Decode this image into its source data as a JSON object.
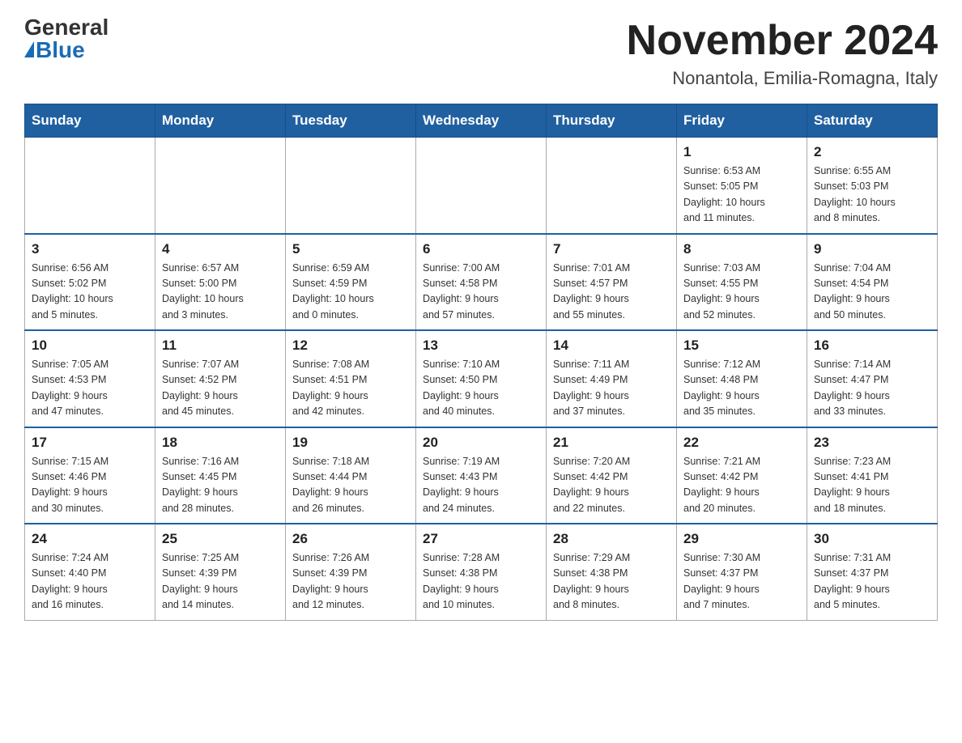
{
  "header": {
    "logo_general": "General",
    "logo_blue": "Blue",
    "title": "November 2024",
    "subtitle": "Nonantola, Emilia-Romagna, Italy"
  },
  "days_of_week": [
    "Sunday",
    "Monday",
    "Tuesday",
    "Wednesday",
    "Thursday",
    "Friday",
    "Saturday"
  ],
  "weeks": [
    [
      {
        "day": "",
        "info": ""
      },
      {
        "day": "",
        "info": ""
      },
      {
        "day": "",
        "info": ""
      },
      {
        "day": "",
        "info": ""
      },
      {
        "day": "",
        "info": ""
      },
      {
        "day": "1",
        "info": "Sunrise: 6:53 AM\nSunset: 5:05 PM\nDaylight: 10 hours\nand 11 minutes."
      },
      {
        "day": "2",
        "info": "Sunrise: 6:55 AM\nSunset: 5:03 PM\nDaylight: 10 hours\nand 8 minutes."
      }
    ],
    [
      {
        "day": "3",
        "info": "Sunrise: 6:56 AM\nSunset: 5:02 PM\nDaylight: 10 hours\nand 5 minutes."
      },
      {
        "day": "4",
        "info": "Sunrise: 6:57 AM\nSunset: 5:00 PM\nDaylight: 10 hours\nand 3 minutes."
      },
      {
        "day": "5",
        "info": "Sunrise: 6:59 AM\nSunset: 4:59 PM\nDaylight: 10 hours\nand 0 minutes."
      },
      {
        "day": "6",
        "info": "Sunrise: 7:00 AM\nSunset: 4:58 PM\nDaylight: 9 hours\nand 57 minutes."
      },
      {
        "day": "7",
        "info": "Sunrise: 7:01 AM\nSunset: 4:57 PM\nDaylight: 9 hours\nand 55 minutes."
      },
      {
        "day": "8",
        "info": "Sunrise: 7:03 AM\nSunset: 4:55 PM\nDaylight: 9 hours\nand 52 minutes."
      },
      {
        "day": "9",
        "info": "Sunrise: 7:04 AM\nSunset: 4:54 PM\nDaylight: 9 hours\nand 50 minutes."
      }
    ],
    [
      {
        "day": "10",
        "info": "Sunrise: 7:05 AM\nSunset: 4:53 PM\nDaylight: 9 hours\nand 47 minutes."
      },
      {
        "day": "11",
        "info": "Sunrise: 7:07 AM\nSunset: 4:52 PM\nDaylight: 9 hours\nand 45 minutes."
      },
      {
        "day": "12",
        "info": "Sunrise: 7:08 AM\nSunset: 4:51 PM\nDaylight: 9 hours\nand 42 minutes."
      },
      {
        "day": "13",
        "info": "Sunrise: 7:10 AM\nSunset: 4:50 PM\nDaylight: 9 hours\nand 40 minutes."
      },
      {
        "day": "14",
        "info": "Sunrise: 7:11 AM\nSunset: 4:49 PM\nDaylight: 9 hours\nand 37 minutes."
      },
      {
        "day": "15",
        "info": "Sunrise: 7:12 AM\nSunset: 4:48 PM\nDaylight: 9 hours\nand 35 minutes."
      },
      {
        "day": "16",
        "info": "Sunrise: 7:14 AM\nSunset: 4:47 PM\nDaylight: 9 hours\nand 33 minutes."
      }
    ],
    [
      {
        "day": "17",
        "info": "Sunrise: 7:15 AM\nSunset: 4:46 PM\nDaylight: 9 hours\nand 30 minutes."
      },
      {
        "day": "18",
        "info": "Sunrise: 7:16 AM\nSunset: 4:45 PM\nDaylight: 9 hours\nand 28 minutes."
      },
      {
        "day": "19",
        "info": "Sunrise: 7:18 AM\nSunset: 4:44 PM\nDaylight: 9 hours\nand 26 minutes."
      },
      {
        "day": "20",
        "info": "Sunrise: 7:19 AM\nSunset: 4:43 PM\nDaylight: 9 hours\nand 24 minutes."
      },
      {
        "day": "21",
        "info": "Sunrise: 7:20 AM\nSunset: 4:42 PM\nDaylight: 9 hours\nand 22 minutes."
      },
      {
        "day": "22",
        "info": "Sunrise: 7:21 AM\nSunset: 4:42 PM\nDaylight: 9 hours\nand 20 minutes."
      },
      {
        "day": "23",
        "info": "Sunrise: 7:23 AM\nSunset: 4:41 PM\nDaylight: 9 hours\nand 18 minutes."
      }
    ],
    [
      {
        "day": "24",
        "info": "Sunrise: 7:24 AM\nSunset: 4:40 PM\nDaylight: 9 hours\nand 16 minutes."
      },
      {
        "day": "25",
        "info": "Sunrise: 7:25 AM\nSunset: 4:39 PM\nDaylight: 9 hours\nand 14 minutes."
      },
      {
        "day": "26",
        "info": "Sunrise: 7:26 AM\nSunset: 4:39 PM\nDaylight: 9 hours\nand 12 minutes."
      },
      {
        "day": "27",
        "info": "Sunrise: 7:28 AM\nSunset: 4:38 PM\nDaylight: 9 hours\nand 10 minutes."
      },
      {
        "day": "28",
        "info": "Sunrise: 7:29 AM\nSunset: 4:38 PM\nDaylight: 9 hours\nand 8 minutes."
      },
      {
        "day": "29",
        "info": "Sunrise: 7:30 AM\nSunset: 4:37 PM\nDaylight: 9 hours\nand 7 minutes."
      },
      {
        "day": "30",
        "info": "Sunrise: 7:31 AM\nSunset: 4:37 PM\nDaylight: 9 hours\nand 5 minutes."
      }
    ]
  ]
}
